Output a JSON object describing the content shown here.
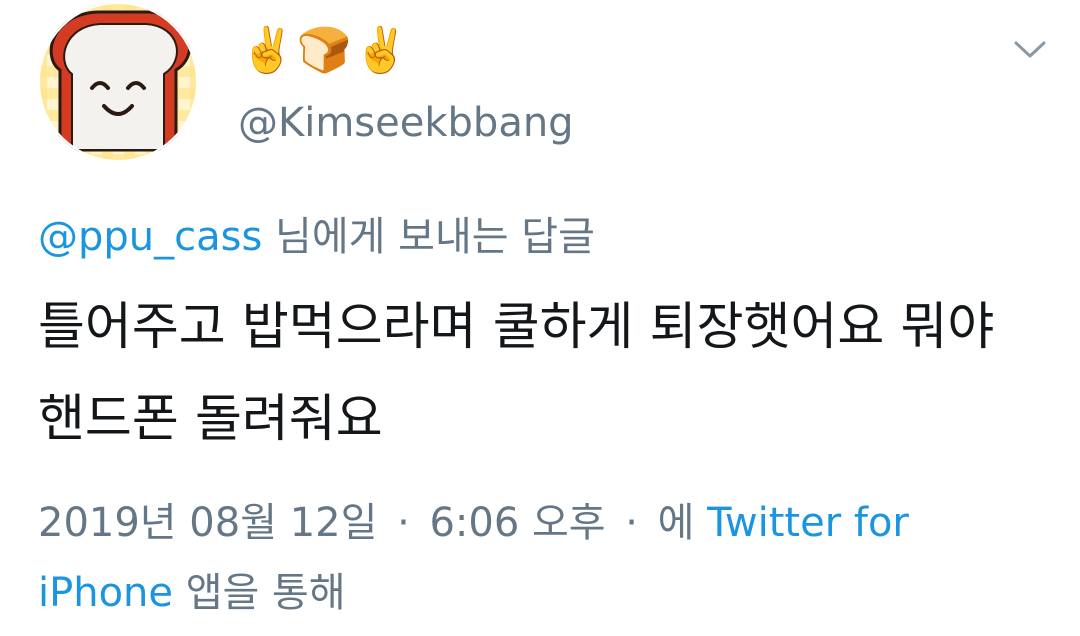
{
  "user": {
    "display_name": "✌️🍞✌️",
    "handle": "@Kimseekbbang"
  },
  "reply": {
    "mention": "@ppu_cass",
    "suffix": " 님에게 보내는 답글"
  },
  "tweet": {
    "text": "틀어주고 밥먹으라며 쿨하게 퇴장햇어요 뭐야 핸드폰 돌려줘요"
  },
  "meta": {
    "date": "2019년 08월 12일",
    "time": "6:06 오후",
    "source_prefix": "에 ",
    "source": "Twitter for iPhone",
    "source_suffix": " 앱을 통해"
  },
  "icons": {
    "avatar": "bread-slice-smiley-icon",
    "menu": "chevron-down-icon"
  },
  "colors": {
    "link": "#1b95e0",
    "secondary_text": "#657786",
    "primary_text": "#14171a"
  }
}
